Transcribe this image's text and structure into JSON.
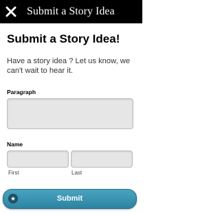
{
  "header": {
    "title": "Submit a Story Idea",
    "close_icon": "close-x-icon"
  },
  "form": {
    "heading": "Submit a Story Idea!",
    "intro_text": "Have a story idea ? Let us know, we can't wait to hear it.",
    "paragraph_label": "Paragraph",
    "paragraph_value": "",
    "name_label": "Name",
    "first_label": "First",
    "last_label": "Last",
    "first_value": "",
    "last_value": "",
    "submit_label": "Submit",
    "submit_icon": "star-icon"
  },
  "colors": {
    "header_bg": "#000000",
    "submit_bg": "#3a94b2",
    "field_bg": "#e6e6e6"
  }
}
